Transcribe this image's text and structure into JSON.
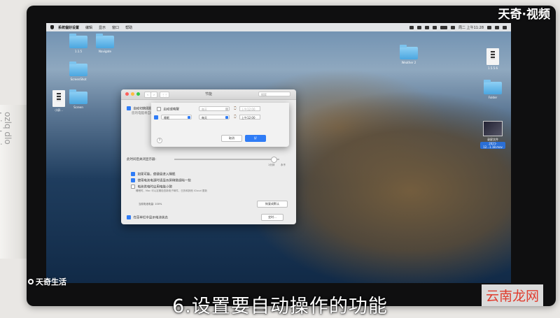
{
  "watermarks": {
    "top_right": "天奇·视频",
    "bottom_left": "天奇生活",
    "bottom_right": "云南龙网"
  },
  "caption": "6.设置要自动操作的功能",
  "menubar": {
    "app_name": "系统偏好设置",
    "items": [
      "编辑",
      "显示",
      "窗口",
      "帮助"
    ],
    "clock": "周二 上午11:28"
  },
  "desktop_icons": [
    {
      "label": "1.1.5",
      "type": "folder"
    },
    {
      "label": "Navigate",
      "type": "folder"
    },
    {
      "label": "ScreenShot",
      "type": "folder"
    },
    {
      "label": "Screen",
      "type": "folder"
    },
    {
      "label": "Weather 2",
      "type": "folder"
    },
    {
      "label": "1.5.5.6",
      "type": "document"
    },
    {
      "label": "小屏...",
      "type": "document"
    },
    {
      "label": "Folder",
      "type": "folder"
    },
    {
      "label": "录屏文件",
      "type": "thumbnail"
    },
    {
      "label": "2021-12...1.18.mov",
      "type": "thumbnail"
    }
  ],
  "window": {
    "title": "节能",
    "search_placeholder": "搜索",
    "nav_back": "‹",
    "nav_fwd": "›",
    "grid_btn": "⋮⋮",
    "auto_switch": "自动切换图形",
    "auto_switch_sub": "您的电脑将自动",
    "display_off_label": "此时间后关闭显示器:",
    "slider_min": "1分钟",
    "slider_max": "永不",
    "options": [
      {
        "label": "如果可能，使硬盘进入睡眠",
        "checked": true
      },
      {
        "label": "使用电池电源时请显示屏稍微调暗一些",
        "checked": true
      },
      {
        "label": "电池供电时启用电能小憩",
        "checked": false
      }
    ],
    "powernap_desc": "睡眠时，Mac 可以定期检查新电子邮件、日历和其他 iCloud 更新",
    "battery_label": "当前电池电量: 100%",
    "restore_btn": "恢复成默认",
    "show_status": "在菜单栏中显示电池状态",
    "schedule_btn": "定时..."
  },
  "sheet": {
    "startup_label": "启动或唤醒",
    "action_value": "睡眠",
    "day_value_dim": "每天",
    "day_value": "每天",
    "time_dim": "上午12:00",
    "time_value": "上午12:00",
    "help": "?",
    "cancel": "取消",
    "ok": "好"
  },
  "colors": {
    "accent": "#2f7cf6",
    "close": "#fc605c",
    "minimize": "#fdbc40",
    "zoom": "#34c84a",
    "watermark_red": "#e03c2e"
  }
}
